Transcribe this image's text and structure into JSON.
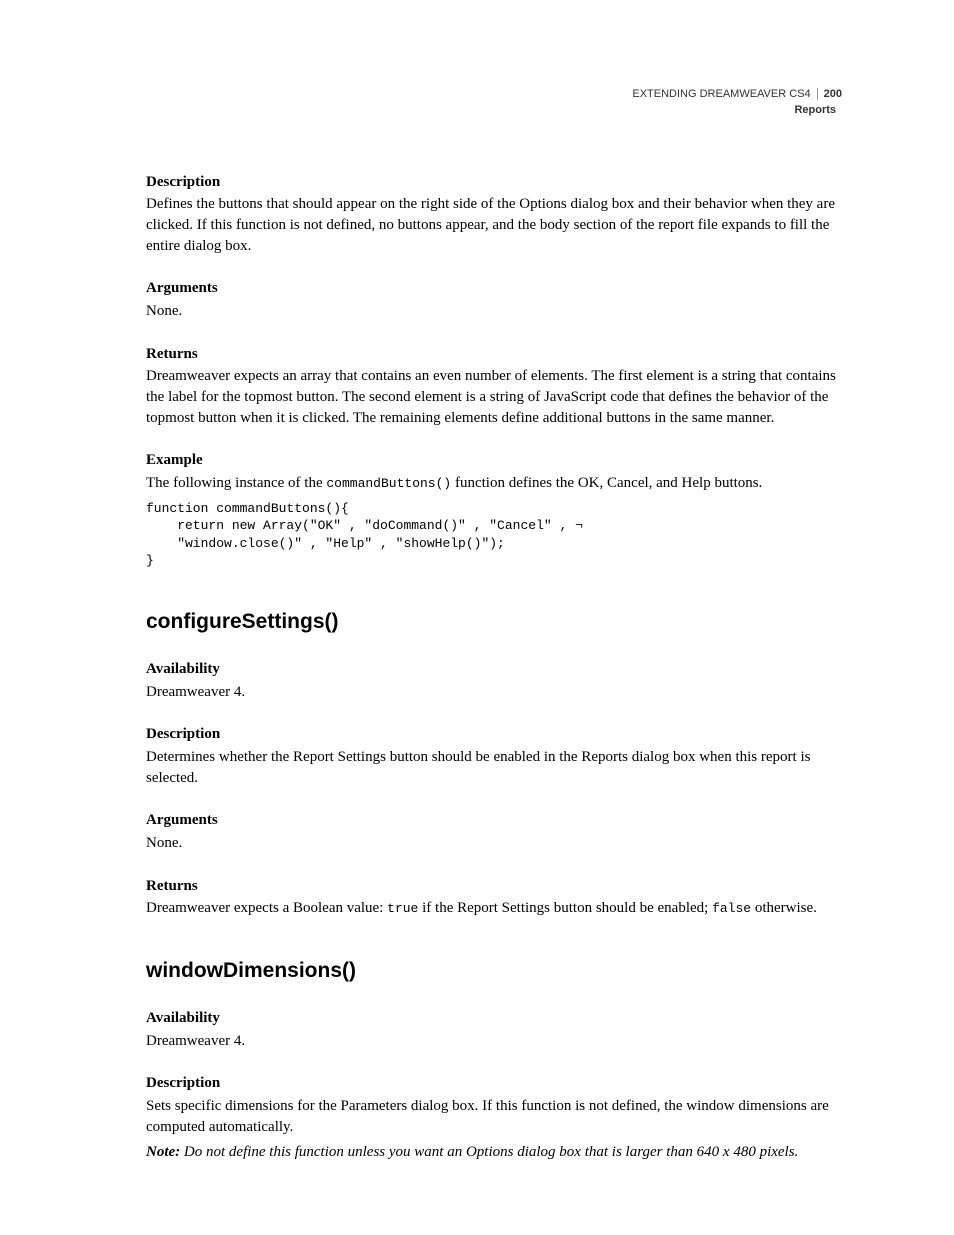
{
  "header": {
    "book_title": "EXTENDING DREAMWEAVER CS4",
    "page_number": "200",
    "section": "Reports"
  },
  "s1": {
    "desc_label": "Description",
    "desc_body": "Defines the buttons that should appear on the right side of the Options dialog box and their behavior when they are clicked. If this function is not defined, no buttons appear, and the body section of the report file expands to fill the entire dialog box.",
    "args_label": "Arguments",
    "args_body": "None.",
    "returns_label": "Returns",
    "returns_body": "Dreamweaver expects an array that contains an even number of elements. The first element is a string that contains the label for the topmost button. The second element is a string of JavaScript code that defines the behavior of the topmost button when it is clicked. The remaining elements define additional buttons in the same manner.",
    "example_label": "Example",
    "example_intro_a": "The following instance of the ",
    "example_intro_code": "commandButtons()",
    "example_intro_b": " function defines the OK, Cancel, and Help buttons.",
    "code": "function commandButtons(){\n    return new Array(\"OK\" , \"doCommand()\" , \"Cancel\" , ¬\n    \"window.close()\" , \"Help\" , \"showHelp()\");\n}"
  },
  "s2": {
    "title": "configureSettings()",
    "avail_label": "Availability",
    "avail_body": "Dreamweaver 4.",
    "desc_label": "Description",
    "desc_body": "Determines whether the Report Settings button should be enabled in the Reports dialog box when this report is selected.",
    "args_label": "Arguments",
    "args_body": "None.",
    "returns_label": "Returns",
    "returns_a": "Dreamweaver expects a Boolean value: ",
    "returns_true": "true",
    "returns_b": " if the Report Settings button should be enabled; ",
    "returns_false": "false",
    "returns_c": " otherwise."
  },
  "s3": {
    "title": "windowDimensions()",
    "avail_label": "Availability",
    "avail_body": "Dreamweaver 4.",
    "desc_label": "Description",
    "desc_body": "Sets specific dimensions for the Parameters dialog box. If this function is not defined, the window dimensions are computed automatically.",
    "note_label": "Note:",
    "note_body": " Do not define this function unless you want an Options dialog box that is larger than 640 x 480 pixels."
  }
}
